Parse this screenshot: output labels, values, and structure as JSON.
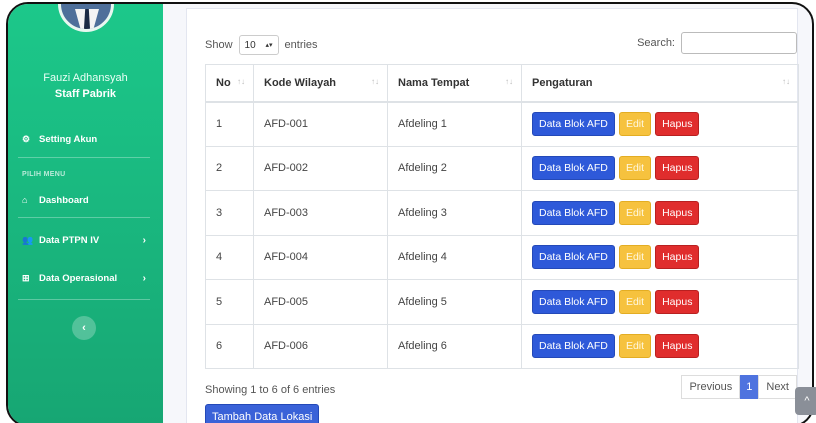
{
  "sidebar": {
    "user_name": "Fauzi Adhansyah",
    "user_role": "Staff Pabrik",
    "setting_label": "Setting Akun",
    "menu_heading": "PILIH MENU",
    "dashboard_label": "Dashboard",
    "ptpn_label": "Data PTPN IV",
    "operasional_label": "Data Operasional",
    "toggle_icon": "‹",
    "accent_color": "#1cc88a"
  },
  "table_controls": {
    "show_label": "Show",
    "entries_value": "10",
    "entries_label": "entries",
    "search_label": "Search:",
    "search_value": ""
  },
  "table": {
    "headers": [
      "No",
      "Kode Wilayah",
      "Nama Tempat",
      "Pengaturan"
    ],
    "rows": [
      {
        "no": "1",
        "kode": "AFD-001",
        "nama": "Afdeling 1"
      },
      {
        "no": "2",
        "kode": "AFD-002",
        "nama": "Afdeling 2"
      },
      {
        "no": "3",
        "kode": "AFD-003",
        "nama": "Afdeling 3"
      },
      {
        "no": "4",
        "kode": "AFD-004",
        "nama": "Afdeling 4"
      },
      {
        "no": "5",
        "kode": "AFD-005",
        "nama": "Afdeling 5"
      },
      {
        "no": "6",
        "kode": "AFD-006",
        "nama": "Afdeling 6"
      }
    ],
    "action_labels": {
      "detail": "Data Blok AFD",
      "edit": "Edit",
      "delete": "Hapus"
    }
  },
  "footer": {
    "info": "Showing 1 to 6 of 6 entries",
    "previous": "Previous",
    "page": "1",
    "next": "Next",
    "add_button": "Tambah Data Lokasi"
  },
  "scroll_top_icon": "^"
}
